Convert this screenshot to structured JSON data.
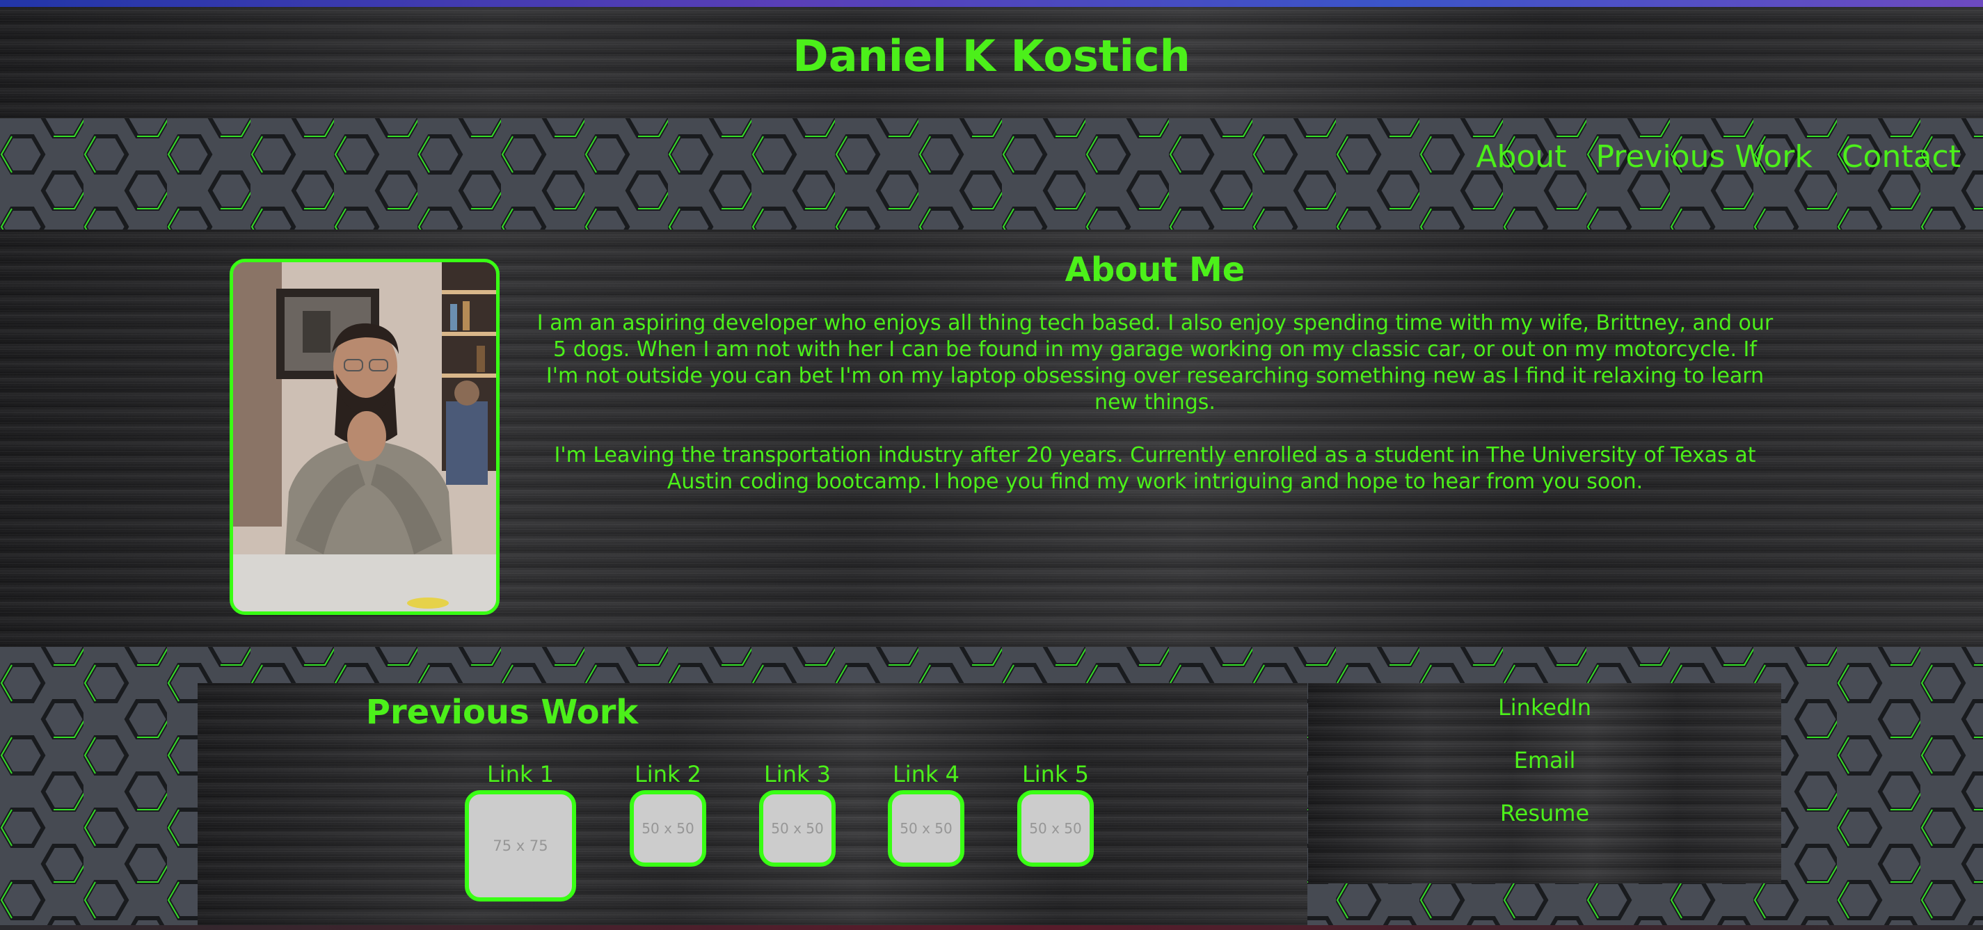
{
  "header": {
    "title": "Daniel K Kostich"
  },
  "nav": {
    "items": [
      {
        "label": "About"
      },
      {
        "label": "Previous Work"
      },
      {
        "label": "Contact"
      }
    ]
  },
  "about": {
    "heading": "About Me",
    "paragraphs": [
      "I am an aspiring developer who enjoys all thing tech based. I also enjoy spending time with my wife, Brittney, and our 5 dogs. When I am not with her I can be found in my garage working on my classic car, or out on my motorcycle. If I'm not outside you can bet I'm on my laptop obsessing over researching something new as I find it relaxing to learn new things.",
      "I'm Leaving the transportation industry after 20 years. Currently enrolled as a student in The University of Texas at Austin coding bootcamp. I hope you find my work intriguing and hope to hear from you soon."
    ]
  },
  "work": {
    "heading": "Previous Work",
    "links": [
      {
        "label": "Link 1",
        "placeholder": "75 x 75"
      },
      {
        "label": "Link 2",
        "placeholder": "50 x 50"
      },
      {
        "label": "Link 3",
        "placeholder": "50 x 50"
      },
      {
        "label": "Link 4",
        "placeholder": "50 x 50"
      },
      {
        "label": "Link 5",
        "placeholder": "50 x 50"
      }
    ]
  },
  "contact": {
    "links": [
      {
        "label": "LinkedIn"
      },
      {
        "label": "Email"
      },
      {
        "label": "Resume"
      }
    ]
  },
  "colors": {
    "accent": "#4cf01a",
    "border": "#39ff14",
    "placeholder_bg": "#cccccc"
  }
}
